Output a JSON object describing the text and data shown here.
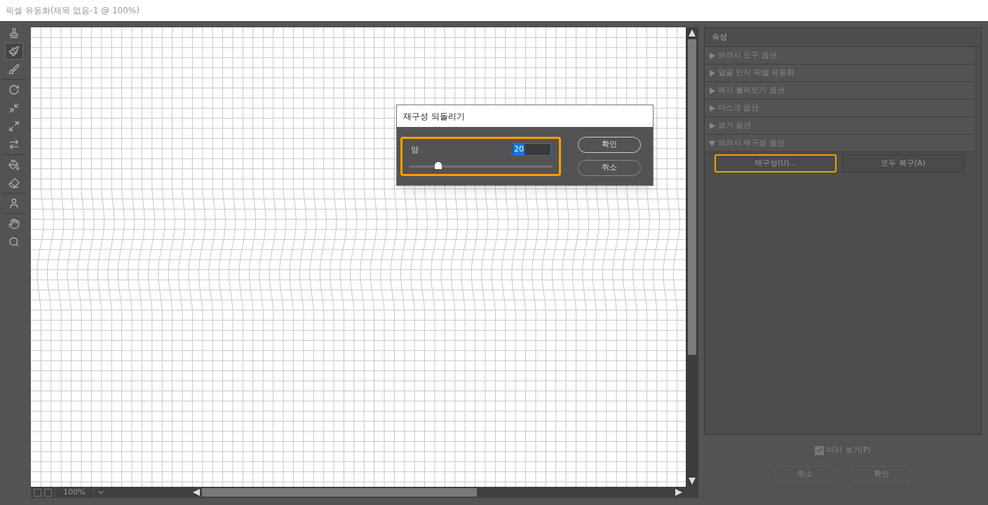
{
  "window": {
    "title": "픽셀 유동화(제목 없음-1 @ 100%)"
  },
  "tool_groups": [
    [
      {
        "selected": false
      },
      {
        "selected": true
      },
      {
        "selected": false
      }
    ],
    [
      {
        "selected": false
      },
      {
        "selected": false
      },
      {
        "selected": false
      },
      {
        "selected": false
      }
    ],
    [
      {
        "selected": false
      },
      {
        "selected": false
      }
    ],
    [
      {
        "selected": false
      }
    ],
    [
      {
        "selected": false
      },
      {
        "selected": false
      }
    ]
  ],
  "canvas_footer": {
    "zoom": "100%"
  },
  "dialog": {
    "title": "재구성 되돌리기",
    "amount": {
      "label": "양",
      "value": "20",
      "level": 0.2,
      "highlighted": true
    },
    "buttons": [
      "확인",
      "취소"
    ]
  },
  "properties": {
    "title": "속성",
    "sections": [
      {
        "label": "브러시 도구 옵션",
        "expanded": false
      },
      {
        "label": "얼굴 인식 픽셀 유동화",
        "expanded": false
      },
      {
        "label": "메시 불러오기 옵션",
        "expanded": false
      },
      {
        "label": "마스크 옵션",
        "expanded": false
      },
      {
        "label": "보기 옵션",
        "expanded": false
      },
      {
        "label": "브러시 재구성 옵션",
        "expanded": true
      }
    ],
    "reconstruct_buttons": [
      {
        "label": "재구성(U)...",
        "highlighted": true
      },
      {
        "label": "모두 복구(A)",
        "highlighted": false
      }
    ]
  },
  "preview": {
    "label": "미리 보기(P)",
    "checked": true
  },
  "footer_buttons": [
    "취소",
    "확인"
  ]
}
